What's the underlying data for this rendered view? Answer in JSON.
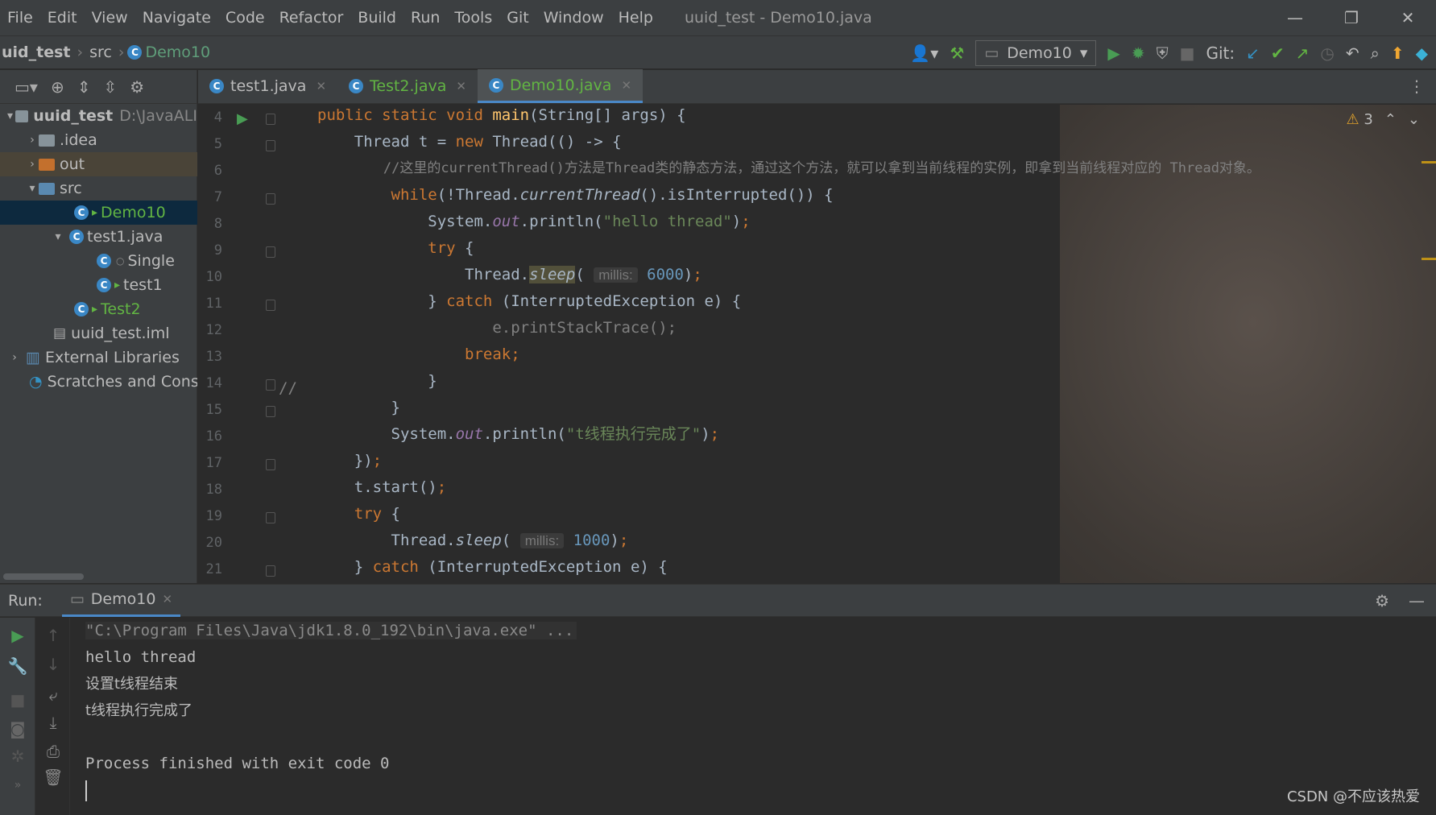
{
  "menu": {
    "items": [
      "File",
      "Edit",
      "View",
      "Navigate",
      "Code",
      "Refactor",
      "Build",
      "Run",
      "Tools",
      "Git",
      "Window",
      "Help"
    ],
    "window_title": "uuid_test - Demo10.java"
  },
  "breadcrumb": {
    "project": "uid_test",
    "folder": "src",
    "file": "Demo10"
  },
  "toolbar": {
    "run_config": "Demo10",
    "git_label": "Git:"
  },
  "project_tree": [
    {
      "label": "uuid_test",
      "suffix": "D:\\JavaALI",
      "kind": "project"
    },
    {
      "label": ".idea",
      "kind": "folder"
    },
    {
      "label": "out",
      "kind": "folder-orange"
    },
    {
      "label": "src",
      "kind": "folder-blue"
    },
    {
      "label": "Demo10",
      "kind": "class-selected"
    },
    {
      "label": "test1.java",
      "kind": "class"
    },
    {
      "label": "Single",
      "kind": "class-inner"
    },
    {
      "label": "test1",
      "kind": "class-inner"
    },
    {
      "label": "Test2",
      "kind": "class-green"
    },
    {
      "label": "uuid_test.iml",
      "kind": "file"
    },
    {
      "label": "External Libraries",
      "kind": "lib"
    },
    {
      "label": "Scratches and Conso",
      "kind": "scratch"
    }
  ],
  "tabs": [
    {
      "label": "test1.java"
    },
    {
      "label": "Test2.java"
    },
    {
      "label": "Demo10.java"
    }
  ],
  "editor": {
    "warning_count": "3",
    "line_numbers": [
      "4",
      "5",
      "6",
      "7",
      "8",
      "9",
      "10",
      "11",
      "12",
      "13",
      "14",
      "15",
      "16",
      "17",
      "18",
      "19",
      "20",
      "21"
    ],
    "hint_millis": "millis:",
    "comment_line": "//这里的currentThread()方法是Thread类的静态方法，通过这个方法，就可以拿到当前线程的实例，即拿到当前线程对应的 Thread对象。",
    "str_hello": "\"hello thread\"",
    "str_done": "\"t线程执行完成了\"",
    "num_6000": "6000",
    "num_1000": "1000",
    "gutter_comment": "//"
  },
  "run": {
    "label": "Run:",
    "tab": "Demo10",
    "console": [
      "\"C:\\Program Files\\Java\\jdk1.8.0_192\\bin\\java.exe\" ...",
      "hello thread",
      "设置t线程结束",
      "t线程执行完成了",
      "",
      "Process finished with exit code 0"
    ]
  },
  "watermark": "CSDN @不应该热爱"
}
